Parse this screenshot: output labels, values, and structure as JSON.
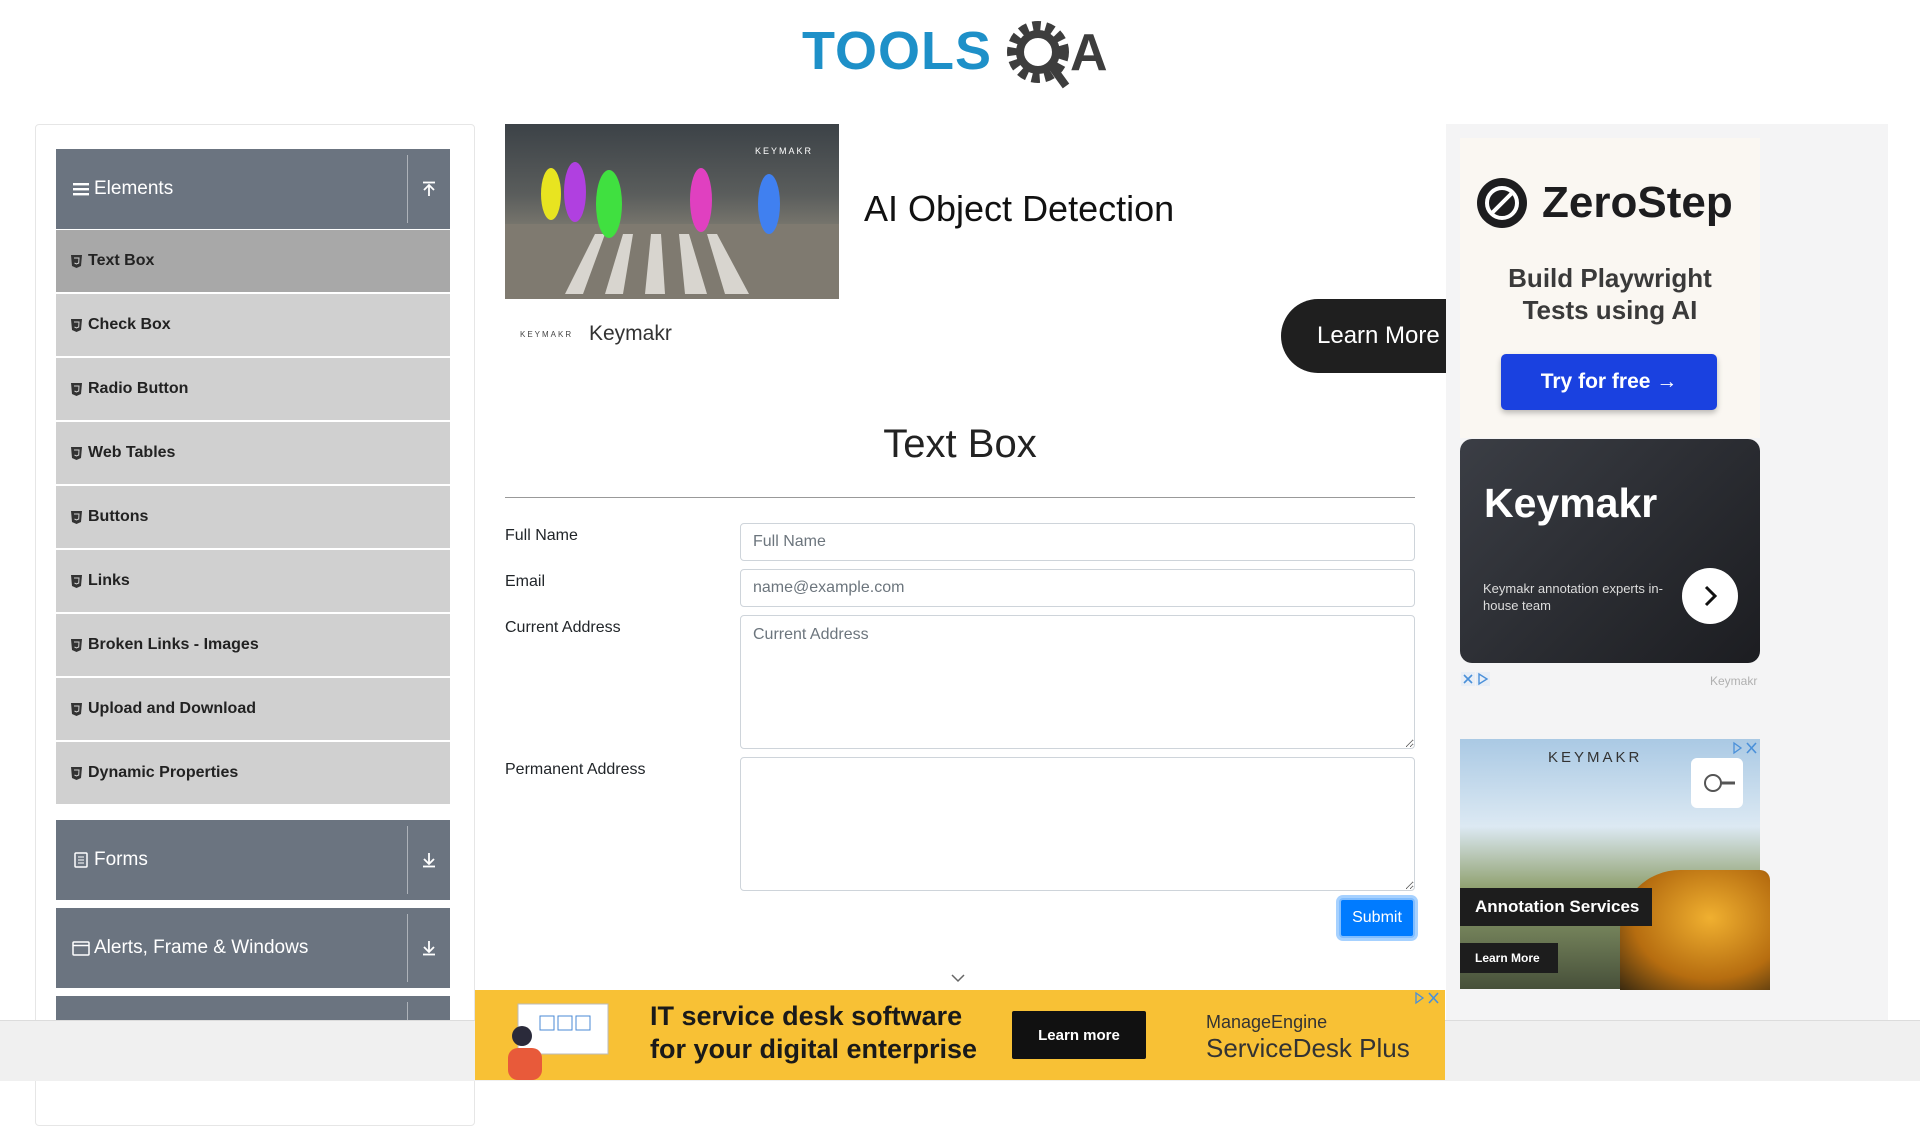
{
  "header": {
    "logo_text": "TOOLSQA"
  },
  "sidebar": {
    "groups": [
      {
        "label": "Elements",
        "icon": "menu-lines-icon",
        "toggle": "collapse-up-icon",
        "expanded": true
      },
      {
        "label": "Forms",
        "icon": "document-icon",
        "toggle": "expand-down-icon"
      },
      {
        "label": "Alerts, Frame & Windows",
        "icon": "window-icon",
        "toggle": "expand-down-icon"
      }
    ],
    "items": [
      {
        "label": "Text Box",
        "active": true
      },
      {
        "label": "Check Box"
      },
      {
        "label": "Radio Button"
      },
      {
        "label": "Web Tables"
      },
      {
        "label": "Buttons"
      },
      {
        "label": "Links"
      },
      {
        "label": "Broken Links - Images"
      },
      {
        "label": "Upload and Download"
      },
      {
        "label": "Dynamic Properties"
      }
    ]
  },
  "top_ad": {
    "image_brand": "KEYMAKR",
    "title": "AI Object Detection",
    "brand_logo": "KEYMAKR",
    "brand": "Keymakr",
    "cta": "Learn More"
  },
  "main": {
    "title": "Text Box",
    "form": {
      "full_name": {
        "label": "Full Name",
        "placeholder": "Full Name"
      },
      "email": {
        "label": "Email",
        "placeholder": "name@example.com"
      },
      "current_address": {
        "label": "Current Address",
        "placeholder": "Current Address"
      },
      "permanent_address": {
        "label": "Permanent Address",
        "placeholder": ""
      },
      "submit": "Submit"
    }
  },
  "right_ads": {
    "zerostep": {
      "name": "ZeroStep",
      "tagline_1": "Build Playwright",
      "tagline_2": "Tests using AI",
      "cta": "Try for free →"
    },
    "keymakr_card": {
      "title": "Keymakr",
      "desc": "Keymakr annotation experts in-house team"
    },
    "keymakr_small": "Keymakr",
    "keymakr_banner": {
      "brand": "KEYMAKR",
      "label": "Annotation Services",
      "cta": "Learn More"
    }
  },
  "bottom_ad": {
    "headline_1": "IT service desk software",
    "headline_2": "for your digital enterprise",
    "cta": "Learn more",
    "brand": "ManageEngine",
    "product": "ServiceDesk Plus"
  },
  "colors": {
    "sidebar_header": "#6b7480",
    "sidebar_item": "#d0d0d0",
    "sidebar_item_active": "#a8a8a8",
    "submit": "#007bff",
    "logo_blue": "#1e90c8",
    "bottom_ad": "#f8c135"
  }
}
